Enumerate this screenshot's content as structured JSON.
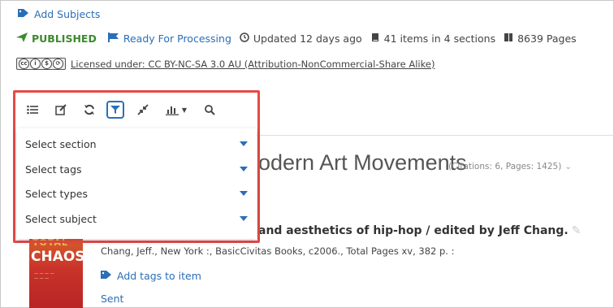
{
  "header": {
    "add_subjects": "Add Subjects",
    "status_published": "PUBLISHED",
    "status_ready": "Ready For Processing",
    "updated": "Updated 12 days ago",
    "items_count": "41 items in 4 sections",
    "pages": "8639 Pages",
    "license_badge": "cc by nc sa",
    "license_text": "Licensed under: CC BY-NC-SA 3.0 AU (Attribution-NonCommercial-Share Alike)"
  },
  "section": {
    "title_visible": "odern Art Movements",
    "meta": "(Citations: 6, Pages: 1425)"
  },
  "item": {
    "title_visible": "and aesthetics of hip-hop / edited by Jeff Chang.",
    "citation": "Chang, Jeff., New York :, BasicCivitas Books, c2006., Total Pages xv, 382 p. :",
    "add_tags": "Add tags to item",
    "status": "Sent",
    "cover_top": "TOTAL",
    "cover_big": "CHAOS"
  },
  "toolbar": {
    "icons": [
      "list-icon",
      "edit-icon",
      "refresh-icon",
      "filter-icon",
      "collapse-icon",
      "chart-icon",
      "search-icon"
    ],
    "active": "filter-icon"
  },
  "filters": [
    {
      "placeholder": "Select section"
    },
    {
      "placeholder": "Select tags"
    },
    {
      "placeholder": "Select types"
    },
    {
      "placeholder": "Select subject"
    }
  ],
  "colors": {
    "link": "#2a6eb8",
    "published": "#3c8a2e",
    "highlight": "#e64a45"
  }
}
